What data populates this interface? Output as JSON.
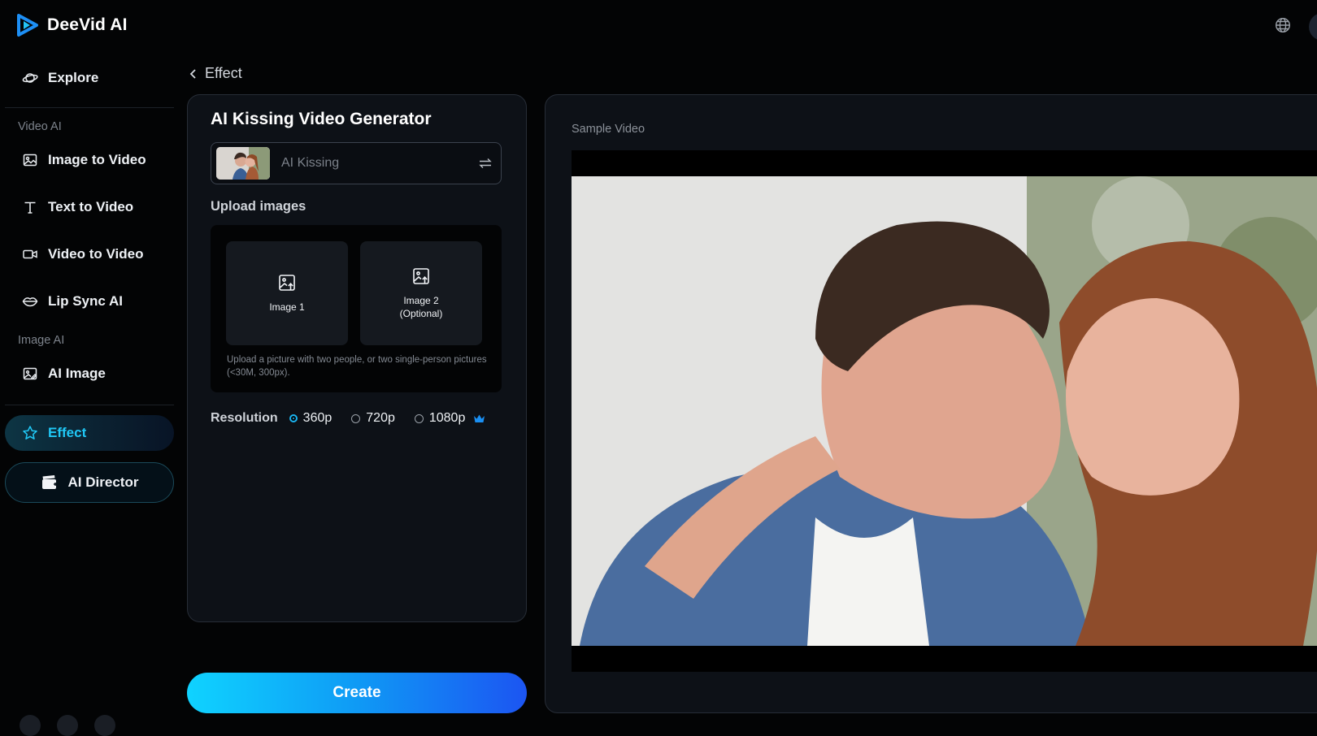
{
  "app": {
    "name": "DeeVid AI"
  },
  "sidebar": {
    "explore": "Explore",
    "section_video": "Video AI",
    "image_to_video": "Image to Video",
    "text_to_video": "Text to Video",
    "video_to_video": "Video to Video",
    "lip_sync": "Lip Sync AI",
    "section_image": "Image AI",
    "ai_image": "AI Image",
    "effect": "Effect",
    "ai_director": "AI Director"
  },
  "breadcrumb": {
    "label": "Effect"
  },
  "panel": {
    "title": "AI Kissing Video Generator",
    "effect_selected": "AI Kissing",
    "upload_label": "Upload images",
    "slot1": "Image 1",
    "slot2": "Image 2\n(Optional)",
    "hint": "Upload a picture with two people, or two single-person pictures (<30M, 300px).",
    "resolution_label": "Resolution",
    "resolutions": [
      "360p",
      "720p",
      "1080p"
    ],
    "selected_resolution": "360p"
  },
  "actions": {
    "create": "Create"
  },
  "preview": {
    "label": "Sample Video"
  },
  "colors": {
    "accent": "#20c8f6",
    "create_start": "#0fd3ff",
    "create_end": "#1c55f2",
    "background": "#030405",
    "panel": "#0d1117"
  },
  "icons": {
    "logo": "play-triangle-logo-icon",
    "globe": "globe-icon",
    "explore": "planet-icon",
    "image_to_video": "image-icon",
    "text_to_video": "text-t-icon",
    "video_to_video": "video-camera-icon",
    "lip_sync": "lips-icon",
    "ai_image": "image-edit-icon",
    "effect": "star-icon",
    "ai_director": "clapper-icon",
    "swap": "swap-arrows-icon",
    "upload": "image-upload-icon",
    "crown": "crown-icon"
  }
}
